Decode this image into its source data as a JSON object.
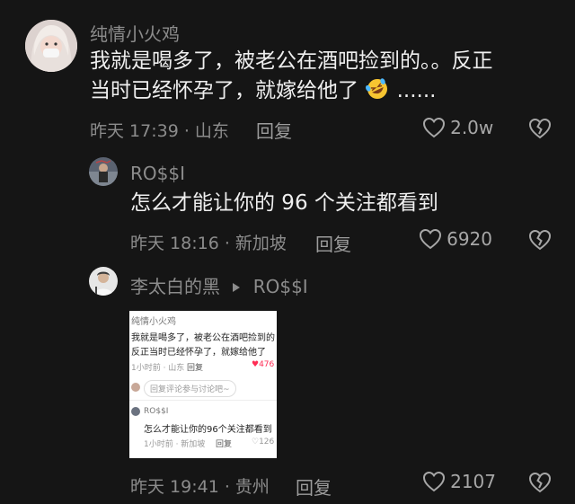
{
  "comments": [
    {
      "username": "纯情小火鸡",
      "text_line1": "我就是喝多了，被老公在酒吧捡到的。。反正",
      "text_line2": "当时已经怀孕了，就嫁给他了",
      "text_tail": "......",
      "emoji": "rofl-emoji",
      "time_location": "昨天 17:39 · 山东",
      "reply_label": "回复",
      "like_count": "2.0w"
    },
    {
      "username": "RO$$I",
      "text": "怎么才能让你的 96 个关注都看到",
      "time_location": "昨天 18:16 · 新加坡",
      "reply_label": "回复",
      "like_count": "6920"
    },
    {
      "username": "李太白的黑",
      "reply_to": "RO$$I",
      "time_location": "昨天 19:41 · 贵州",
      "reply_label": "回复",
      "like_count": "2107"
    }
  ],
  "embedded_screenshot": {
    "username": "纯情小火鸡",
    "line1": "我就是喝多了，被老公在酒吧捡到的",
    "line2": "反正当时已经怀孕了，就嫁给他了",
    "meta": "1小时前 · 山东",
    "reply_label": "回复",
    "likes": "476",
    "reply_prompt": "回复评论参与讨论吧~",
    "sub_username": "RO$$I",
    "sub_text": "怎么才能让你的96个关注都看到",
    "sub_meta": "1小时前 · 新加坡",
    "sub_reply_label": "回复",
    "sub_likes": "126"
  },
  "colors": {
    "background": "#151515",
    "text": "#efefef",
    "muted": "#8c8c8c",
    "like_red": "#ff2d55"
  }
}
